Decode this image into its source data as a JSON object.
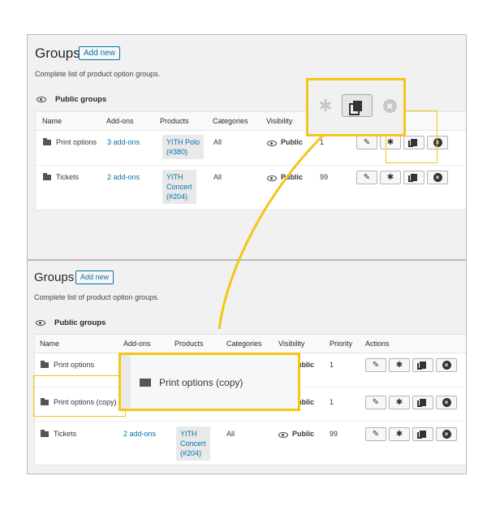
{
  "colors": {
    "accent": "#f5c518",
    "link": "#0073aa"
  },
  "before": {
    "title": "Groups",
    "add_new": "Add new",
    "description": "Complete list of product option groups.",
    "section": "Public groups",
    "headers": {
      "name": "Name",
      "addons": "Add-ons",
      "products": "Products",
      "categories": "Categories",
      "visibility": "Visibility"
    },
    "rows": [
      {
        "name": "Print options",
        "addons": "3 add-ons",
        "product": "YITH Polo (#380)",
        "product_lines": [
          "YITH Polo",
          "(#380)"
        ],
        "categories": "All",
        "visibility": "Public",
        "priority": "1"
      },
      {
        "name": "Tickets",
        "addons": "2 add-ons",
        "product": "YITH Concert (#204)",
        "product_lines": [
          "YITH",
          "Concert",
          "(#204)"
        ],
        "categories": "All",
        "visibility": "Public",
        "priority": "99"
      }
    ]
  },
  "after": {
    "title": "Groups",
    "add_new": "Add new",
    "description": "Complete list of product option groups.",
    "section": "Public groups",
    "headers": {
      "name": "Name",
      "addons": "Add-ons",
      "products": "Products",
      "categories": "Categories",
      "visibility": "Visibility",
      "priority": "Priority",
      "actions": "Actions"
    },
    "rows": [
      {
        "name": "Print options",
        "visibility": "Public",
        "priority": "1"
      },
      {
        "name": "Print options (copy)",
        "visibility": "Public",
        "priority": "1"
      },
      {
        "name": "Tickets",
        "addons": "2 add-ons",
        "product_lines": [
          "YITH",
          "Concert",
          "(#204)"
        ],
        "categories": "All",
        "visibility": "Public",
        "priority": "99"
      }
    ]
  },
  "zoom_copy_label": "Print options (copy)",
  "icons": [
    "folder-icon",
    "eye-icon",
    "edit-icon",
    "gear-icon",
    "duplicate-icon",
    "delete-icon"
  ]
}
